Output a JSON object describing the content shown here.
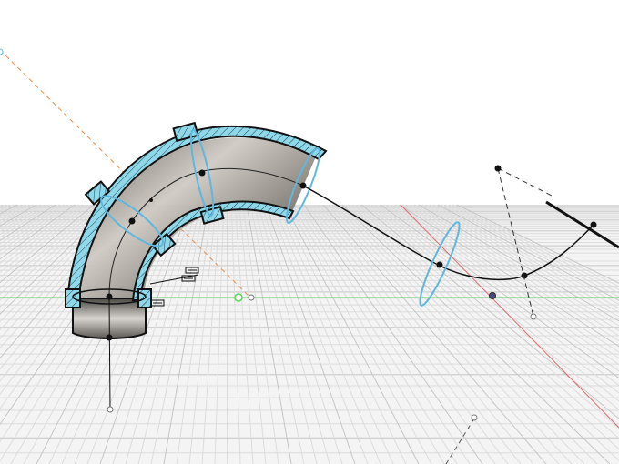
{
  "viewport": {
    "name": "3D CAD viewport",
    "background_color": "#ffffff",
    "ground_color": "#f4f4f4",
    "grid_minor_color": "#dcdcdc",
    "grid_major_color": "#c6c6c6"
  },
  "axes": {
    "x_axis_color": "#59d659",
    "y_axis_color": "#e06a6a",
    "construction_line_color": "#e8904a"
  },
  "model": {
    "pipe_section_color": "#8fd8ea",
    "pipe_interior_color": "#6d6861",
    "selection_color": "#5fb7df",
    "path_color": "#111111"
  },
  "icons": [
    "constraint-icon",
    "origin-point-icon",
    "control-point-icon"
  ]
}
